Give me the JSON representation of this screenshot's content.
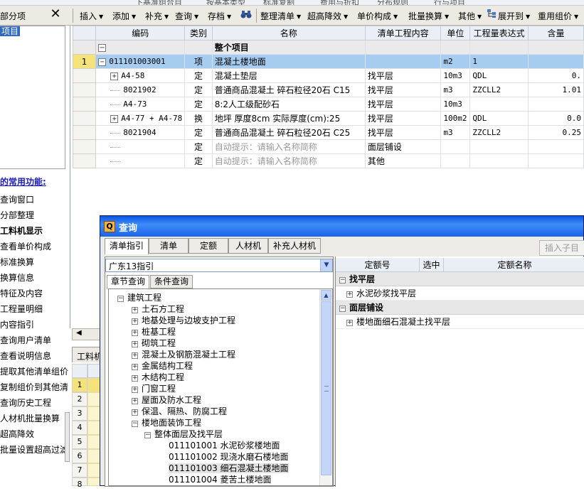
{
  "topstrip": {
    "text_a": "下基准组合目",
    "text_b": "按基本类型",
    "text_c": "标准复制",
    "text_d": "费用与折扣",
    "text_e": "分布规则",
    "text_f": "行与项目"
  },
  "left_panel": {
    "title": "部分项",
    "close_glyph": "✕",
    "tree_item": "项目",
    "funcs_title": "的常用功能:",
    "funcs": [
      "查询窗口",
      "分部整理",
      "工料机显示",
      "查看单价构成",
      "标准换算",
      "换算信息",
      "特征及内容",
      "工程量明细",
      "内容指引",
      "查询用户清单",
      "查看说明信息",
      "提取其他清单组价",
      "复制组价到其他清",
      "查询历史工程",
      "人材机批量换算",
      "超高降效",
      "批量设置超高过滤"
    ]
  },
  "toolbar": {
    "insert": "插入",
    "add": "添加",
    "supplement": "补充",
    "query": "查询",
    "archive": "存档",
    "find_icon": "binoculars-icon",
    "tidy": "整理清单",
    "super_efficiency": "超高降效",
    "unit_price": "单价构成",
    "batch_convert": "批量换算",
    "other": "其他",
    "expand": "展开到",
    "reuse": "重用组价"
  },
  "grid": {
    "headers": [
      "编码",
      "类别",
      "名称",
      "清单工程内容",
      "单位",
      "工程量表达式",
      "含量"
    ],
    "project_row": {
      "name": "整个项目"
    },
    "rows": [
      {
        "num": "1",
        "code": "011101003001",
        "type": "项",
        "name": "混凝土楼地面",
        "content": "",
        "unit": "m2",
        "expr": "1",
        "qty": ""
      },
      {
        "num": "",
        "code": "A4-58",
        "type": "定",
        "name": "混凝土垫层",
        "content": "找平层",
        "unit": "10m3",
        "expr": "QDL",
        "qty": "0."
      },
      {
        "num": "",
        "code": "8021902",
        "type": "定",
        "name": "普通商品混凝土 碎石粒径20石 C15",
        "content": "找平层",
        "unit": "m3",
        "expr": "ZZCLL2",
        "qty": "1.01"
      },
      {
        "num": "",
        "code": "A4-73",
        "type": "定",
        "name": "8:2人工级配砂石",
        "content": "找平层",
        "unit": "10m3",
        "expr": "",
        "qty": ""
      },
      {
        "num": "",
        "code": "A4-77 + A4-78",
        "type": "换",
        "name": "地坪 厚度8cm 实际厚度(cm):25",
        "content": "找平层",
        "unit": "100m2",
        "expr": "QDL",
        "qty": "0.0"
      },
      {
        "num": "",
        "code": "8021904",
        "type": "定",
        "name": "普通商品混凝土 碎石粒径20石 C25",
        "content": "找平层",
        "unit": "m3",
        "expr": "ZZCLL2",
        "qty": "0.25"
      },
      {
        "num": "",
        "code": "",
        "type": "定",
        "name": "自动提示：请输入名称简称",
        "content": "面层铺设",
        "unit": "",
        "expr": "",
        "qty": ""
      },
      {
        "num": "",
        "code": "",
        "type": "定",
        "name": "自动提示：请输入名称简称",
        "content": "其他",
        "unit": "",
        "expr": "",
        "qty": ""
      }
    ]
  },
  "bottom": {
    "tab": "工料机",
    "scroll_arrow": "◀",
    "rows": [
      "1",
      "2",
      "3",
      "4",
      "5",
      "6",
      "7",
      "8"
    ]
  },
  "dialog": {
    "title": "查询",
    "tabs": [
      "清单指引",
      "清单",
      "定额",
      "人材机",
      "补充人材机"
    ],
    "insert_child": "插入子目",
    "library": "广东13指引",
    "subtabs": [
      "章节查询",
      "条件查询"
    ],
    "tree": [
      {
        "label": "建筑工程",
        "pm": "−"
      },
      {
        "label": "土石方工程",
        "pm": "+"
      },
      {
        "label": "地基处理与边坡支护工程",
        "pm": "+"
      },
      {
        "label": "桩基工程",
        "pm": "+"
      },
      {
        "label": "砌筑工程",
        "pm": "+"
      },
      {
        "label": "混凝土及钢筋混凝土工程",
        "pm": "+"
      },
      {
        "label": "金属结构工程",
        "pm": "+"
      },
      {
        "label": "木结构工程",
        "pm": "+"
      },
      {
        "label": "门窗工程",
        "pm": "+"
      },
      {
        "label": "屋面及防水工程",
        "pm": "+"
      },
      {
        "label": "保温、隔热、防腐工程",
        "pm": "+"
      },
      {
        "label": "楼地面装饰工程",
        "pm": "−"
      },
      {
        "label": "整体面层及找平层",
        "pm": "−"
      },
      {
        "label": "011101001  水泥砂浆楼地面",
        "pm": ""
      },
      {
        "label": "011101002  现浇水磨石楼地面",
        "pm": ""
      },
      {
        "label": "011101003  细石混凝土楼地面",
        "pm": ""
      },
      {
        "label": "011101004  菱苦土楼地面",
        "pm": ""
      }
    ],
    "right_headers": [
      "定额号",
      "选中",
      "定额名称"
    ],
    "groups": [
      {
        "name": "找平层",
        "items": [
          "水泥砂浆找平层"
        ]
      },
      {
        "name": "面层铺设",
        "items": [
          "楼地面细石混凝土找平层"
        ]
      }
    ]
  },
  "colors": {
    "selection": "#a6ccf0",
    "rownum_selected": "#f5e27a",
    "title_bar": "#0a54e3",
    "link_blue": "#1d1db5"
  }
}
